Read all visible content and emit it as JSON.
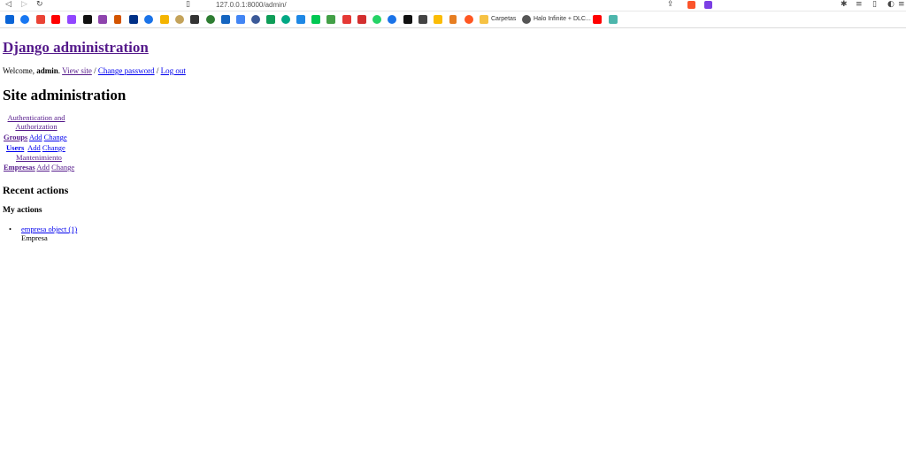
{
  "browser": {
    "url": "127.0.0.1:8000/admin/",
    "bookmarks": [
      {
        "label": "Carpetas"
      },
      {
        "label": "Halo Infinite + DLC..."
      }
    ]
  },
  "header": {
    "site_title": "Django administration",
    "welcome_prefix": "Welcome, ",
    "username": "admin",
    "welcome_suffix": ". ",
    "view_site": "View site",
    "separator1": " / ",
    "change_password": "Change password",
    "separator2": " / ",
    "log_out": "Log out"
  },
  "main": {
    "title": "Site administration",
    "apps": [
      {
        "caption_line1": "Authentication and",
        "caption_line2": "Authorization",
        "models": [
          {
            "name": "Groups",
            "add": "Add",
            "change": "Change"
          },
          {
            "name": "Users",
            "add": "Add",
            "change": "Change"
          }
        ]
      },
      {
        "caption_line1": "Mantenimiento",
        "models": [
          {
            "name": "Empresas",
            "add": "Add",
            "change": "Change"
          }
        ]
      }
    ]
  },
  "sidebar": {
    "recent_title": "Recent actions",
    "my_actions_title": "My actions",
    "actions": [
      {
        "object": "empresa object (1)",
        "type": "Empresa"
      }
    ]
  },
  "colors": {
    "link": "#0000ee",
    "visited_link": "#551a8b"
  }
}
